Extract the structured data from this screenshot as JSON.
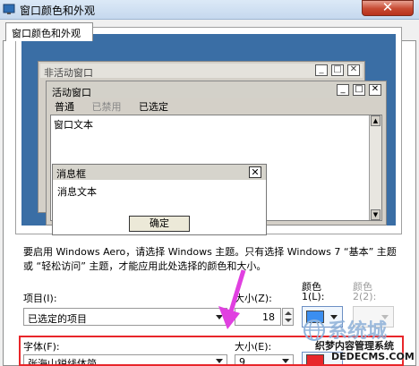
{
  "window": {
    "title": "窗口颜色和外观",
    "close_glyph": "✕"
  },
  "tabs": [
    {
      "label": "窗口颜色和外观"
    }
  ],
  "preview": {
    "inactive_title": "非活动窗口",
    "active_title": "活动窗口",
    "menu_items": [
      "普通",
      "已禁用",
      "已选定"
    ],
    "window_text": "窗口文本",
    "msgbox_title": "消息框",
    "msgbox_text": "消息文本",
    "ok_label": "确定",
    "cap_min": "_",
    "cap_max": "□",
    "cap_close": "✕"
  },
  "help_text": "要启用 Windows Aero，请选择 Windows 主题。只有选择 Windows 7 “基本” 主题或 “轻松访问” 主题，才能应用此处选择的颜色和大小。",
  "item_row": {
    "label": "项目(I):",
    "value": "已选定的项目",
    "size_label": "大小(Z):",
    "size_value": "18",
    "color1_label_a": "颜色",
    "color1_label_b": "1(L):",
    "color2_label_a": "颜色",
    "color2_label_b": "2(2):",
    "color1": "#3b8ef0"
  },
  "font_row": {
    "label": "字体(F):",
    "value": "张海山锐线体简",
    "size_label": "大小(E):",
    "size_value": "9",
    "color": "#e8262a"
  },
  "watermark": {
    "logo_text": "系统城",
    "site_cn": "织梦内容管理系统",
    "site_en": "DEDECMS.COM"
  },
  "colors": {
    "highlight": "#e8262a",
    "arrow": "#e040e0"
  }
}
